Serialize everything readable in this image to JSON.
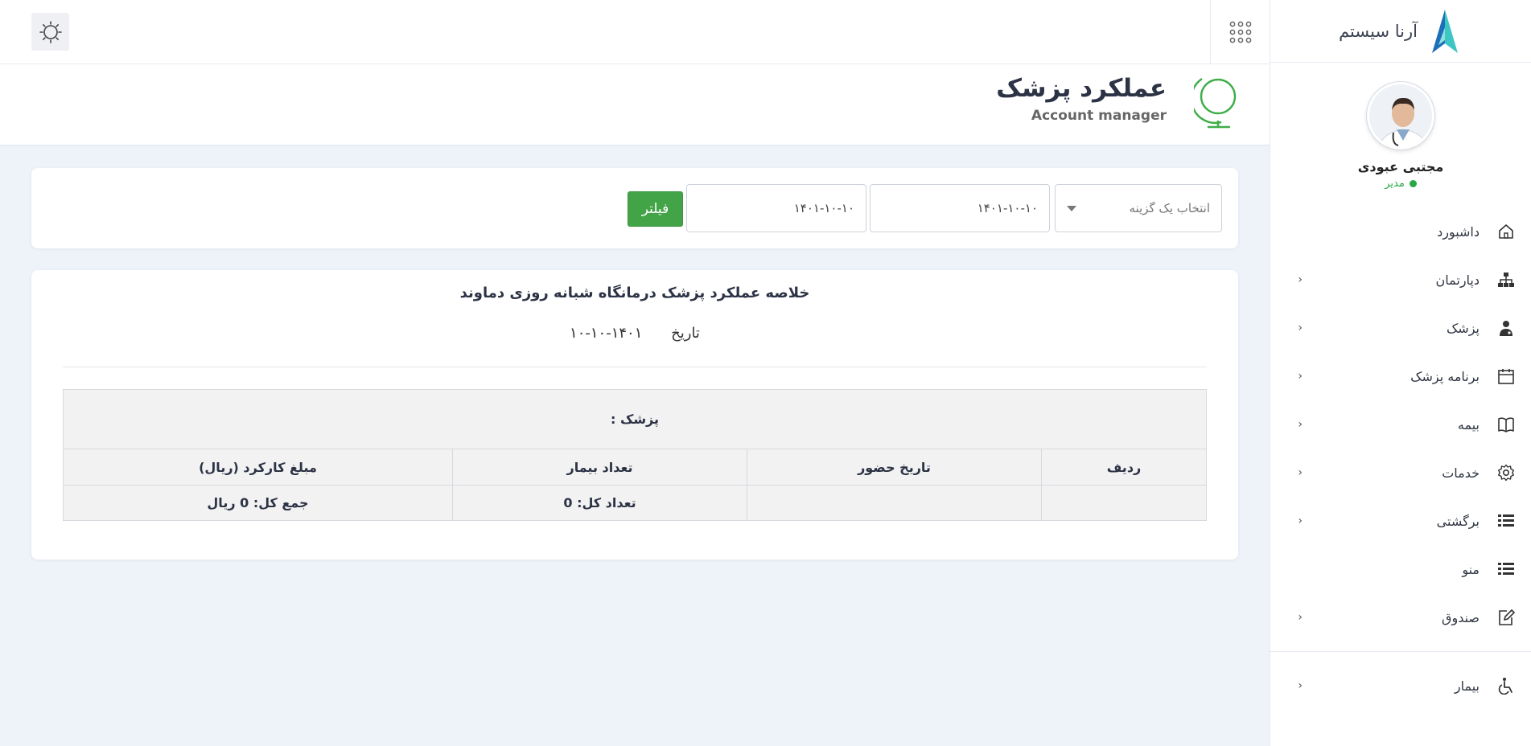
{
  "brand": {
    "name": "آرنا سیستم"
  },
  "profile": {
    "name": "مجتبی عبودی",
    "role": "مدیر"
  },
  "menu": [
    {
      "label": "داشبورد",
      "icon": "home-icon",
      "has_submenu": false
    },
    {
      "label": "دپارتمان",
      "icon": "sitemap-icon",
      "has_submenu": true
    },
    {
      "label": "پزشک",
      "icon": "doctor-icon",
      "has_submenu": true
    },
    {
      "label": "برنامه پزشک",
      "icon": "calendar-icon",
      "has_submenu": true
    },
    {
      "label": "بیمه",
      "icon": "book-icon",
      "has_submenu": true
    },
    {
      "label": "خدمات",
      "icon": "gear-icon",
      "has_submenu": true
    },
    {
      "label": "برگشتی",
      "icon": "list-icon",
      "has_submenu": true
    },
    {
      "label": "منو",
      "icon": "list-icon",
      "has_submenu": false
    },
    {
      "label": "صندوق",
      "icon": "edit-icon",
      "has_submenu": true
    },
    {
      "label": "بیمار",
      "icon": "wheelchair-icon",
      "has_submenu": true
    }
  ],
  "page": {
    "title": "عملکرد پزشک",
    "subtitle": "Account manager"
  },
  "filter": {
    "select_placeholder": "انتخاب یک گزینه",
    "date_from": "۱۴۰۱-۱۰-۱۰",
    "date_to": "۱۴۰۱-۱۰-۱۰",
    "button_label": "فیلتر"
  },
  "report": {
    "title": "خلاصه عملکرد پزشک درمانگاه شبانه روزی دماوند",
    "date_label": "تاریخ",
    "date_value": "۱۴۰۱-۱۰-۱۰",
    "doctor_header": "پزشک :",
    "columns": [
      "ردیف",
      "تاریخ حضور",
      "تعداد بیمار",
      "مبلغ کارکرد (ریال)"
    ],
    "summary": {
      "count": "تعداد کل: 0",
      "total": "جمع کل: 0 ریال"
    }
  },
  "colors": {
    "accent_green": "#43a447",
    "online": "#28a745",
    "brand_teal": "#1fb5b5"
  }
}
